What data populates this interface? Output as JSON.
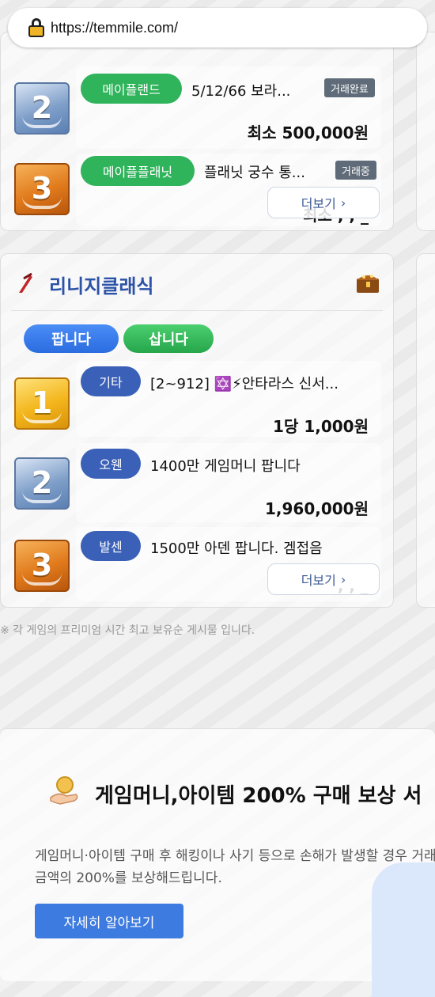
{
  "browser": {
    "url": "https://temmile.com/"
  },
  "maple": {
    "items": [
      {
        "rank": "2",
        "category": "메이플랜드",
        "title": "5/12/66 보라...",
        "status": "거래완료",
        "price": "최소 500,000원"
      },
      {
        "rank": "3",
        "category": "메이플플래닛",
        "title": "플래닛 궁수 통...",
        "status": "거래중",
        "price": "최소 ,  ,  _"
      }
    ],
    "more_label": "더보기"
  },
  "lineage": {
    "title": "리니지클래식",
    "tabs": [
      "팝니다",
      "삽니다"
    ],
    "items": [
      {
        "rank": "1",
        "category": "기타",
        "title": "[2~912] ✡️⚡안타라스 신서...",
        "price": "1당 1,000원"
      },
      {
        "rank": "2",
        "category": "오웬",
        "title": "1400만 게임머니 팝니다",
        "price": "1,960,000원"
      },
      {
        "rank": "3",
        "category": "발센",
        "title": "1500만 아덴 팝니다. 겜접음",
        "price": ",  ,  _"
      }
    ],
    "more_label": "더보기"
  },
  "note": "※ 각 게임의 프리미엄 시간 최고 보유순 게시물 입니다.",
  "banner": {
    "title": "게임머니,아이템 200% 구매 보상 서",
    "desc": "게임머니·아이템 구매 후 해킹이나 사기 등으로 손해가 발생할 경우 거래 금액의 200%를 보상해드립니다.",
    "button": "자세히 알아보기"
  }
}
